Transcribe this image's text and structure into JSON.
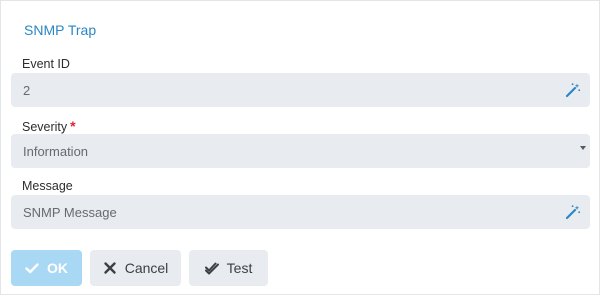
{
  "dialog": {
    "title": "SNMP Trap"
  },
  "fields": {
    "event_id": {
      "label": "Event ID",
      "value": "2",
      "icon": "magic-wand-icon"
    },
    "severity": {
      "label": "Severity",
      "required_mark": "*",
      "value": "Information",
      "icon": "chevron-down-icon"
    },
    "message": {
      "label": "Message",
      "value": "SNMP Message",
      "icon": "magic-wand-icon"
    }
  },
  "buttons": {
    "ok": {
      "label": "OK",
      "icon": "check-icon"
    },
    "cancel": {
      "label": "Cancel",
      "icon": "close-icon"
    },
    "test": {
      "label": "Test",
      "icon": "double-check-icon"
    }
  },
  "colors": {
    "title": "#2b86c5",
    "field_bg": "#e8ebef",
    "ok_bg": "#a9d8f4",
    "required": "#e0262f",
    "wand_icon": "#2b86c5"
  }
}
